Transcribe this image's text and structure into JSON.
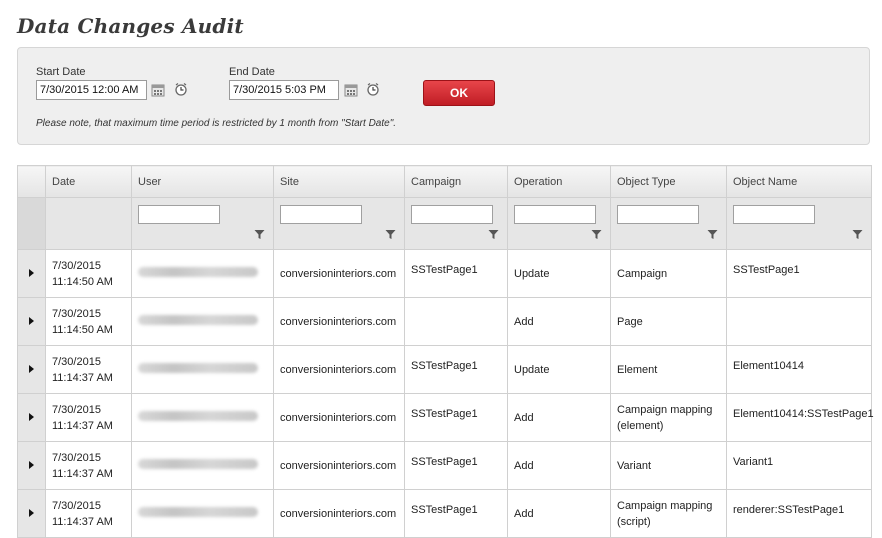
{
  "page": {
    "title": "Data Changes Audit"
  },
  "filters": {
    "start_label": "Start Date",
    "start_value": "7/30/2015 12:00 AM",
    "end_label": "End Date",
    "end_value": "7/30/2015 5:03 PM",
    "ok_label": "OK",
    "note": "Please note, that maximum time period is restricted by 1 month from \"Start Date\"."
  },
  "grid": {
    "columns": [
      "Date",
      "User",
      "Site",
      "Campaign",
      "Operation",
      "Object Type",
      "Object Name"
    ],
    "rows": [
      {
        "date_line1": "7/30/2015",
        "date_line2": "11:14:50 AM",
        "site": "conversioninteriors.com",
        "campaign": "SSTestPage1",
        "operation": "Update",
        "object_type": "Campaign",
        "object_type_line2": "",
        "object_name": "SSTestPage1"
      },
      {
        "date_line1": "7/30/2015",
        "date_line2": "11:14:50 AM",
        "site": "conversioninteriors.com",
        "campaign": "",
        "operation": "Add",
        "object_type": "Page",
        "object_type_line2": "",
        "object_name": ""
      },
      {
        "date_line1": "7/30/2015",
        "date_line2": "11:14:37 AM",
        "site": "conversioninteriors.com",
        "campaign": "SSTestPage1",
        "operation": "Update",
        "object_type": "Element",
        "object_type_line2": "",
        "object_name": "Element10414"
      },
      {
        "date_line1": "7/30/2015",
        "date_line2": "11:14:37 AM",
        "site": "conversioninteriors.com",
        "campaign": "SSTestPage1",
        "operation": "Add",
        "object_type": "Campaign mapping",
        "object_type_line2": "(element)",
        "object_name": "Element10414:SSTestPage1"
      },
      {
        "date_line1": "7/30/2015",
        "date_line2": "11:14:37 AM",
        "site": "conversioninteriors.com",
        "campaign": "SSTestPage1",
        "operation": "Add",
        "object_type": "Variant",
        "object_type_line2": "",
        "object_name": "Variant1"
      },
      {
        "date_line1": "7/30/2015",
        "date_line2": "11:14:37 AM",
        "site": "conversioninteriors.com",
        "campaign": "SSTestPage1",
        "operation": "Add",
        "object_type": "Campaign mapping",
        "object_type_line2": "(script)",
        "object_name": "renderer:SSTestPage1"
      }
    ]
  }
}
